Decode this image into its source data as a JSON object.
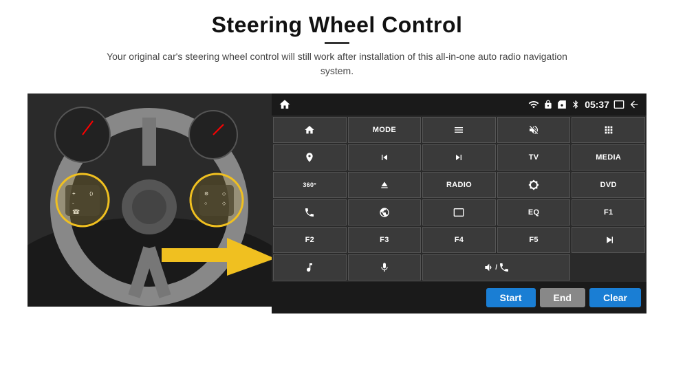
{
  "page": {
    "title": "Steering Wheel Control",
    "subtitle": "Your original car's steering wheel control will still work after installation of this all-in-one auto radio navigation system."
  },
  "status_bar": {
    "time": "05:37",
    "icons": [
      "wifi",
      "lock",
      "sim",
      "bluetooth",
      "screen-mirror",
      "back"
    ]
  },
  "buttons": [
    {
      "id": "home",
      "type": "icon",
      "icon": "home"
    },
    {
      "id": "mode",
      "type": "text",
      "label": "MODE"
    },
    {
      "id": "list",
      "type": "icon",
      "icon": "list"
    },
    {
      "id": "mute",
      "type": "icon",
      "icon": "mute"
    },
    {
      "id": "apps",
      "type": "icon",
      "icon": "apps"
    },
    {
      "id": "nav",
      "type": "icon",
      "icon": "nav"
    },
    {
      "id": "prev",
      "type": "icon",
      "icon": "prev"
    },
    {
      "id": "next",
      "type": "icon",
      "icon": "next"
    },
    {
      "id": "tv",
      "type": "text",
      "label": "TV"
    },
    {
      "id": "media",
      "type": "text",
      "label": "MEDIA"
    },
    {
      "id": "cam360",
      "type": "icon",
      "icon": "360cam"
    },
    {
      "id": "eject",
      "type": "icon",
      "icon": "eject"
    },
    {
      "id": "radio",
      "type": "text",
      "label": "RADIO"
    },
    {
      "id": "brightness",
      "type": "icon",
      "icon": "brightness"
    },
    {
      "id": "dvd",
      "type": "text",
      "label": "DVD"
    },
    {
      "id": "phone",
      "type": "icon",
      "icon": "phone"
    },
    {
      "id": "browse",
      "type": "icon",
      "icon": "browse"
    },
    {
      "id": "window",
      "type": "icon",
      "icon": "window"
    },
    {
      "id": "eq",
      "type": "text",
      "label": "EQ"
    },
    {
      "id": "f1",
      "type": "text",
      "label": "F1"
    },
    {
      "id": "f2",
      "type": "text",
      "label": "F2"
    },
    {
      "id": "f3",
      "type": "text",
      "label": "F3"
    },
    {
      "id": "f4",
      "type": "text",
      "label": "F4"
    },
    {
      "id": "f5",
      "type": "text",
      "label": "F5"
    },
    {
      "id": "playpause",
      "type": "icon",
      "icon": "playpause"
    },
    {
      "id": "music",
      "type": "icon",
      "icon": "music"
    },
    {
      "id": "mic",
      "type": "icon",
      "icon": "mic"
    },
    {
      "id": "volphone",
      "type": "icon",
      "icon": "volphone"
    },
    {
      "id": "empty1",
      "type": "empty",
      "label": ""
    },
    {
      "id": "empty2",
      "type": "empty",
      "label": ""
    }
  ],
  "bottom_bar": {
    "start_label": "Start",
    "end_label": "End",
    "clear_label": "Clear"
  }
}
